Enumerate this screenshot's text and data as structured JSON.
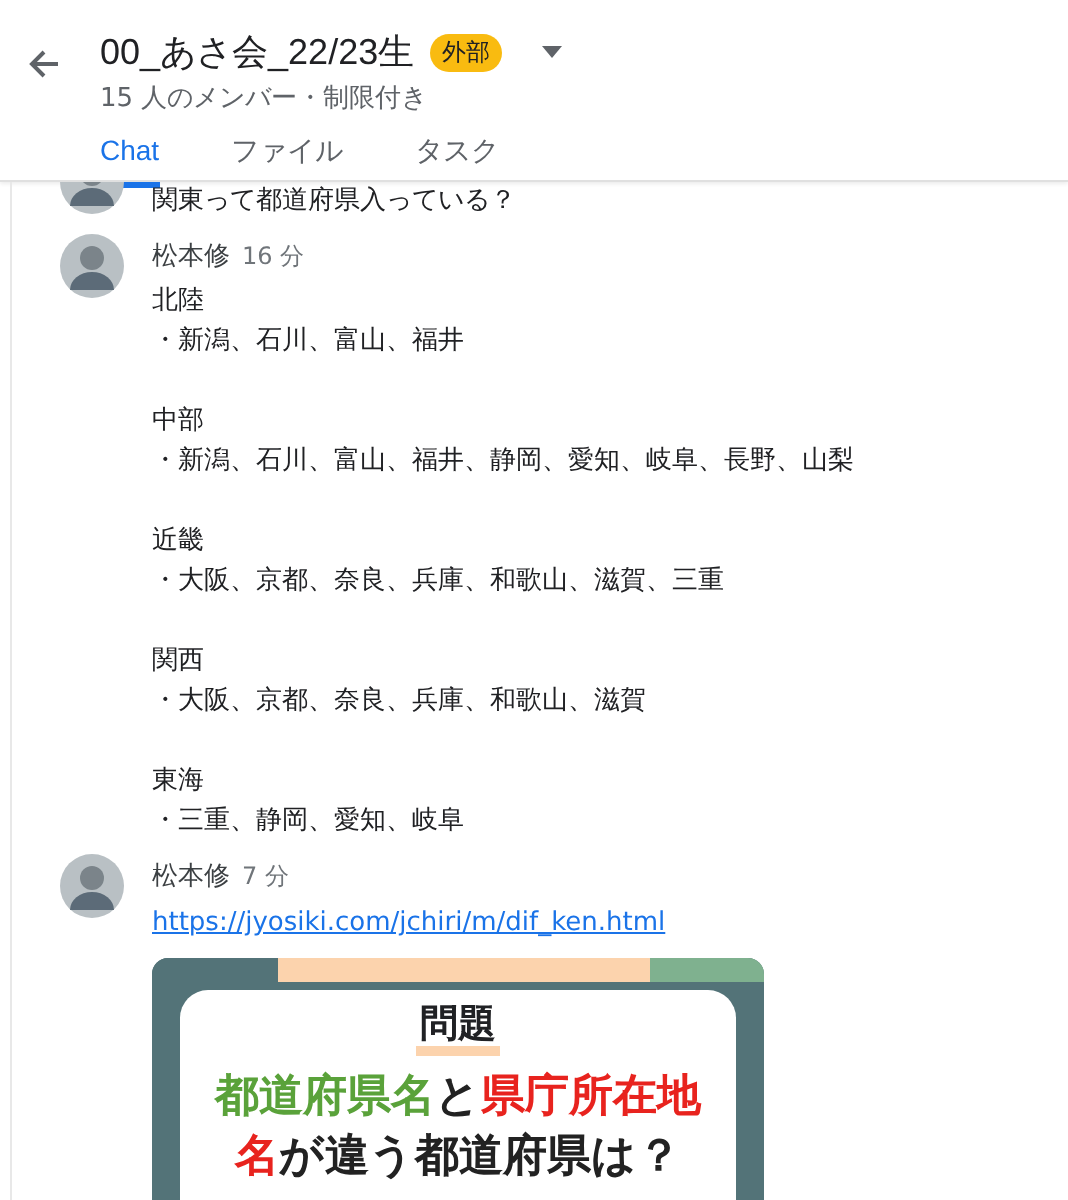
{
  "header": {
    "title": "00_あさ会_22/23生",
    "badge": "外部",
    "subtitle": "15 人のメンバー・制限付き"
  },
  "tabs": [
    {
      "label": "Chat",
      "selected": true
    },
    {
      "label": "ファイル",
      "selected": false
    },
    {
      "label": "タスク",
      "selected": false
    }
  ],
  "messages": [
    {
      "kind": "continued",
      "blocks": [
        [
          "関東って都道府県入っている？"
        ]
      ]
    },
    {
      "kind": "text",
      "author": "松本修",
      "time": "16 分",
      "blocks": [
        [
          "北陸",
          "・新潟、石川、富山、福井"
        ],
        [
          "中部",
          "・新潟、石川、富山、福井、静岡、愛知、岐阜、長野、山梨"
        ],
        [
          "近畿",
          "・大阪、京都、奈良、兵庫、和歌山、滋賀、三重"
        ],
        [
          "関西",
          "・大阪、京都、奈良、兵庫、和歌山、滋賀"
        ],
        [
          "東海",
          "・三重、静岡、愛知、岐阜"
        ]
      ]
    },
    {
      "kind": "link",
      "author": "松本修",
      "time": "7 分",
      "link": "https://jyosiki.com/jchiri/m/dif_ken.html",
      "preview": {
        "heading": "問題",
        "lines": [
          [
            {
              "text": "都道府県名",
              "color": "#5aa23a"
            },
            {
              "text": "と",
              "color": "#222222"
            },
            {
              "text": "県庁所在地",
              "color": "#e8231e"
            }
          ],
          [
            {
              "text": "名",
              "color": "#e8231e"
            },
            {
              "text": "が違う都道府県は？",
              "color": "#222222"
            }
          ]
        ]
      }
    }
  ]
}
